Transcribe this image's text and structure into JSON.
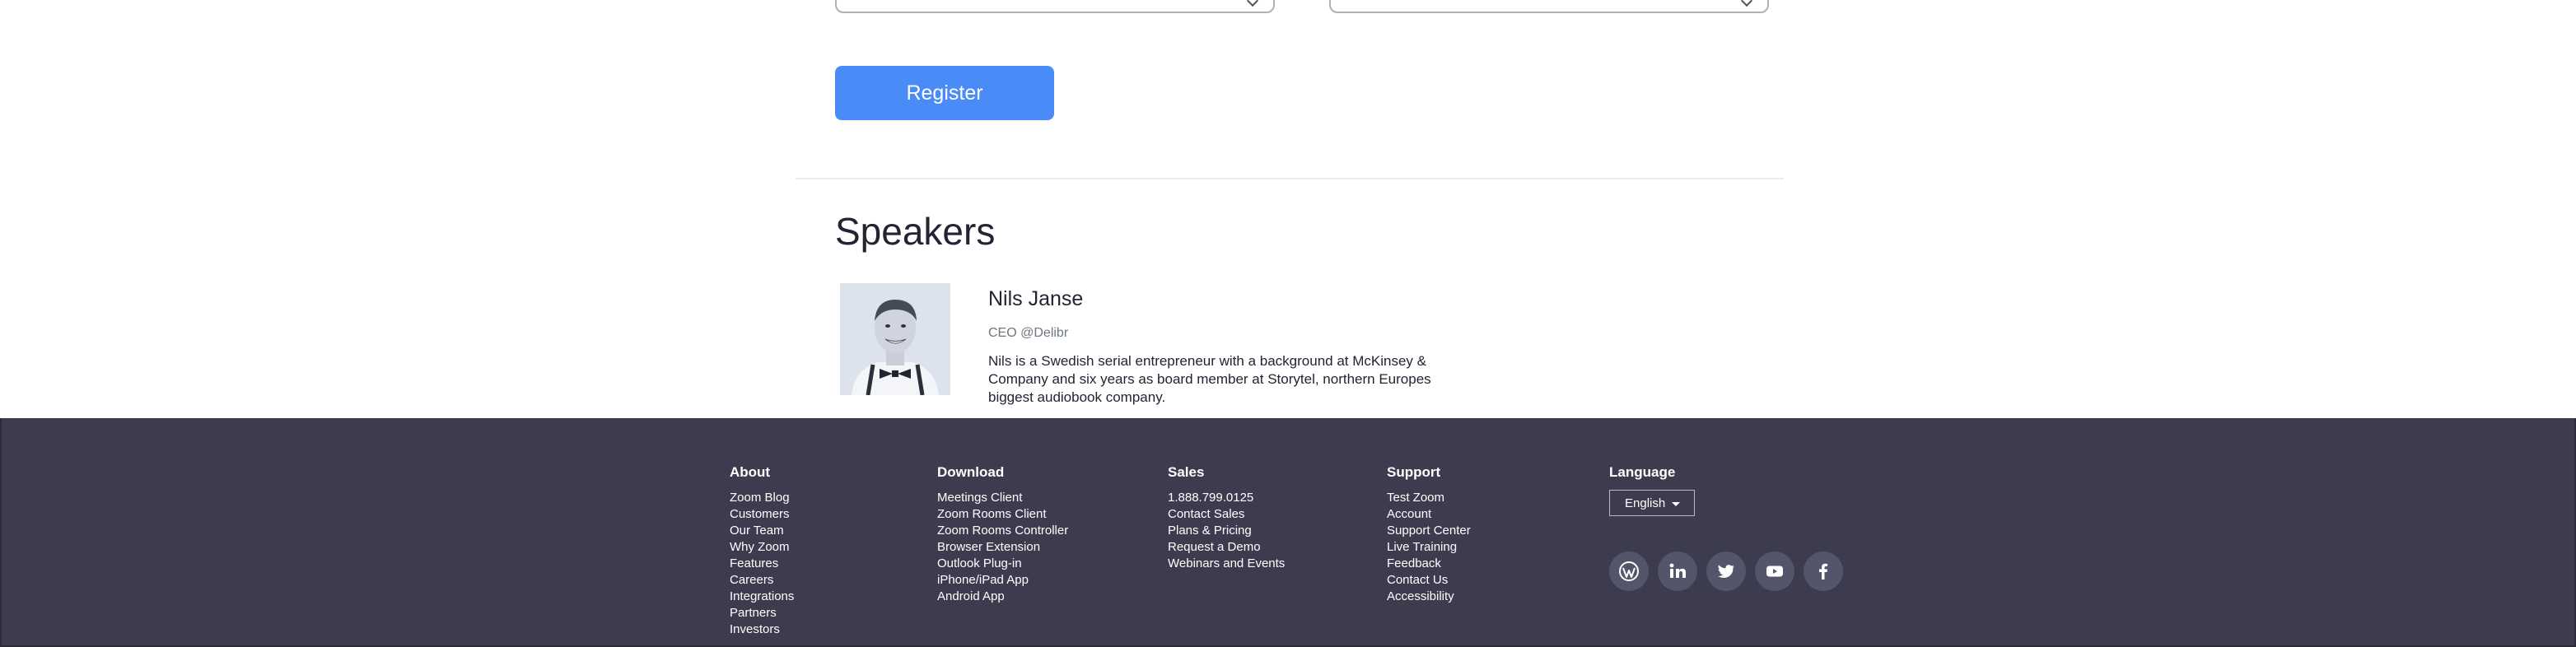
{
  "register": {
    "label": "Register"
  },
  "speakers": {
    "heading": "Speakers",
    "items": [
      {
        "name": "Nils Janse",
        "role": "CEO @Delibr",
        "bio": "Nils is a Swedish serial entrepreneur with a background at McKinsey & Company and six years as board member at Storytel, northern Europes biggest audiobook company."
      }
    ]
  },
  "footer": {
    "about": {
      "title": "About",
      "items": [
        "Zoom Blog",
        "Customers",
        "Our Team",
        "Why Zoom",
        "Features",
        "Careers",
        "Integrations",
        "Partners",
        "Investors"
      ]
    },
    "download": {
      "title": "Download",
      "items": [
        "Meetings Client",
        "Zoom Rooms Client",
        "Zoom Rooms Controller",
        "Browser Extension",
        "Outlook Plug-in",
        "iPhone/iPad App",
        "Android App"
      ]
    },
    "sales": {
      "title": "Sales",
      "items": [
        "1.888.799.0125",
        "Contact Sales",
        "Plans & Pricing",
        "Request a Demo",
        "Webinars and Events"
      ]
    },
    "support": {
      "title": "Support",
      "items": [
        "Test Zoom",
        "Account",
        "Support Center",
        "Live Training",
        "Feedback",
        "Contact Us",
        "Accessibility"
      ]
    },
    "language": {
      "title": "Language",
      "selected": "English"
    },
    "social": [
      "wordpress-icon",
      "linkedin-icon",
      "twitter-icon",
      "youtube-icon",
      "facebook-icon"
    ]
  },
  "colors": {
    "accent": "#4a8cf7",
    "footer_bg": "#3c3c4e",
    "text": "#232333"
  }
}
